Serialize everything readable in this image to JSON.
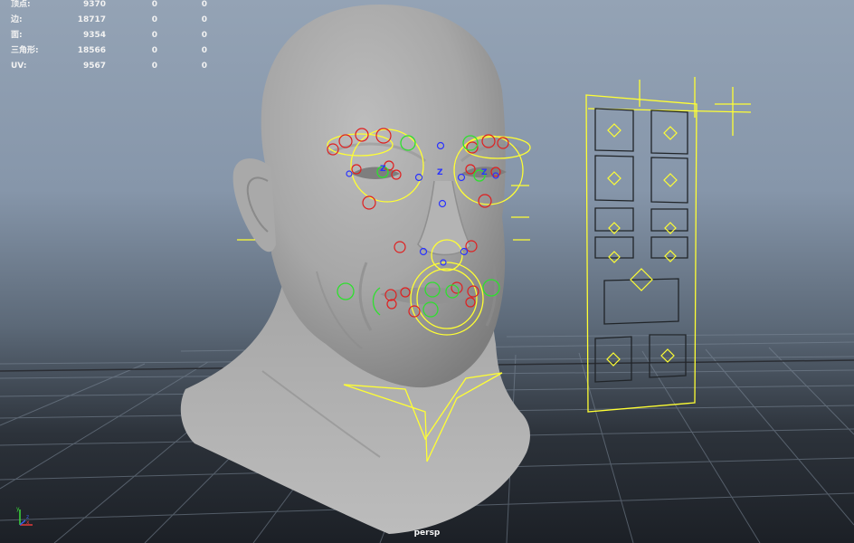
{
  "viewport": {
    "camera": "persp",
    "hud": [
      {
        "label": "顶点:",
        "values": [
          "9370",
          "0",
          "0"
        ]
      },
      {
        "label": "边:",
        "values": [
          "18717",
          "0",
          "0"
        ]
      },
      {
        "label": "面:",
        "values": [
          "9354",
          "0",
          "0"
        ]
      },
      {
        "label": "三角形:",
        "values": [
          "18566",
          "0",
          "0"
        ]
      },
      {
        "label": "UV:",
        "values": [
          "9567",
          "0",
          "0"
        ]
      }
    ],
    "axis": {
      "x_label": "x",
      "y_label": "y",
      "z_label": "z"
    }
  },
  "rig": {
    "colors": {
      "control": "#ffff33",
      "red_control": "#e01f1f",
      "green_control": "#2ee02e",
      "blue_control": "#2a33ff"
    },
    "eye_markers": [
      "Z",
      "Z"
    ],
    "center_marker": "Z"
  }
}
